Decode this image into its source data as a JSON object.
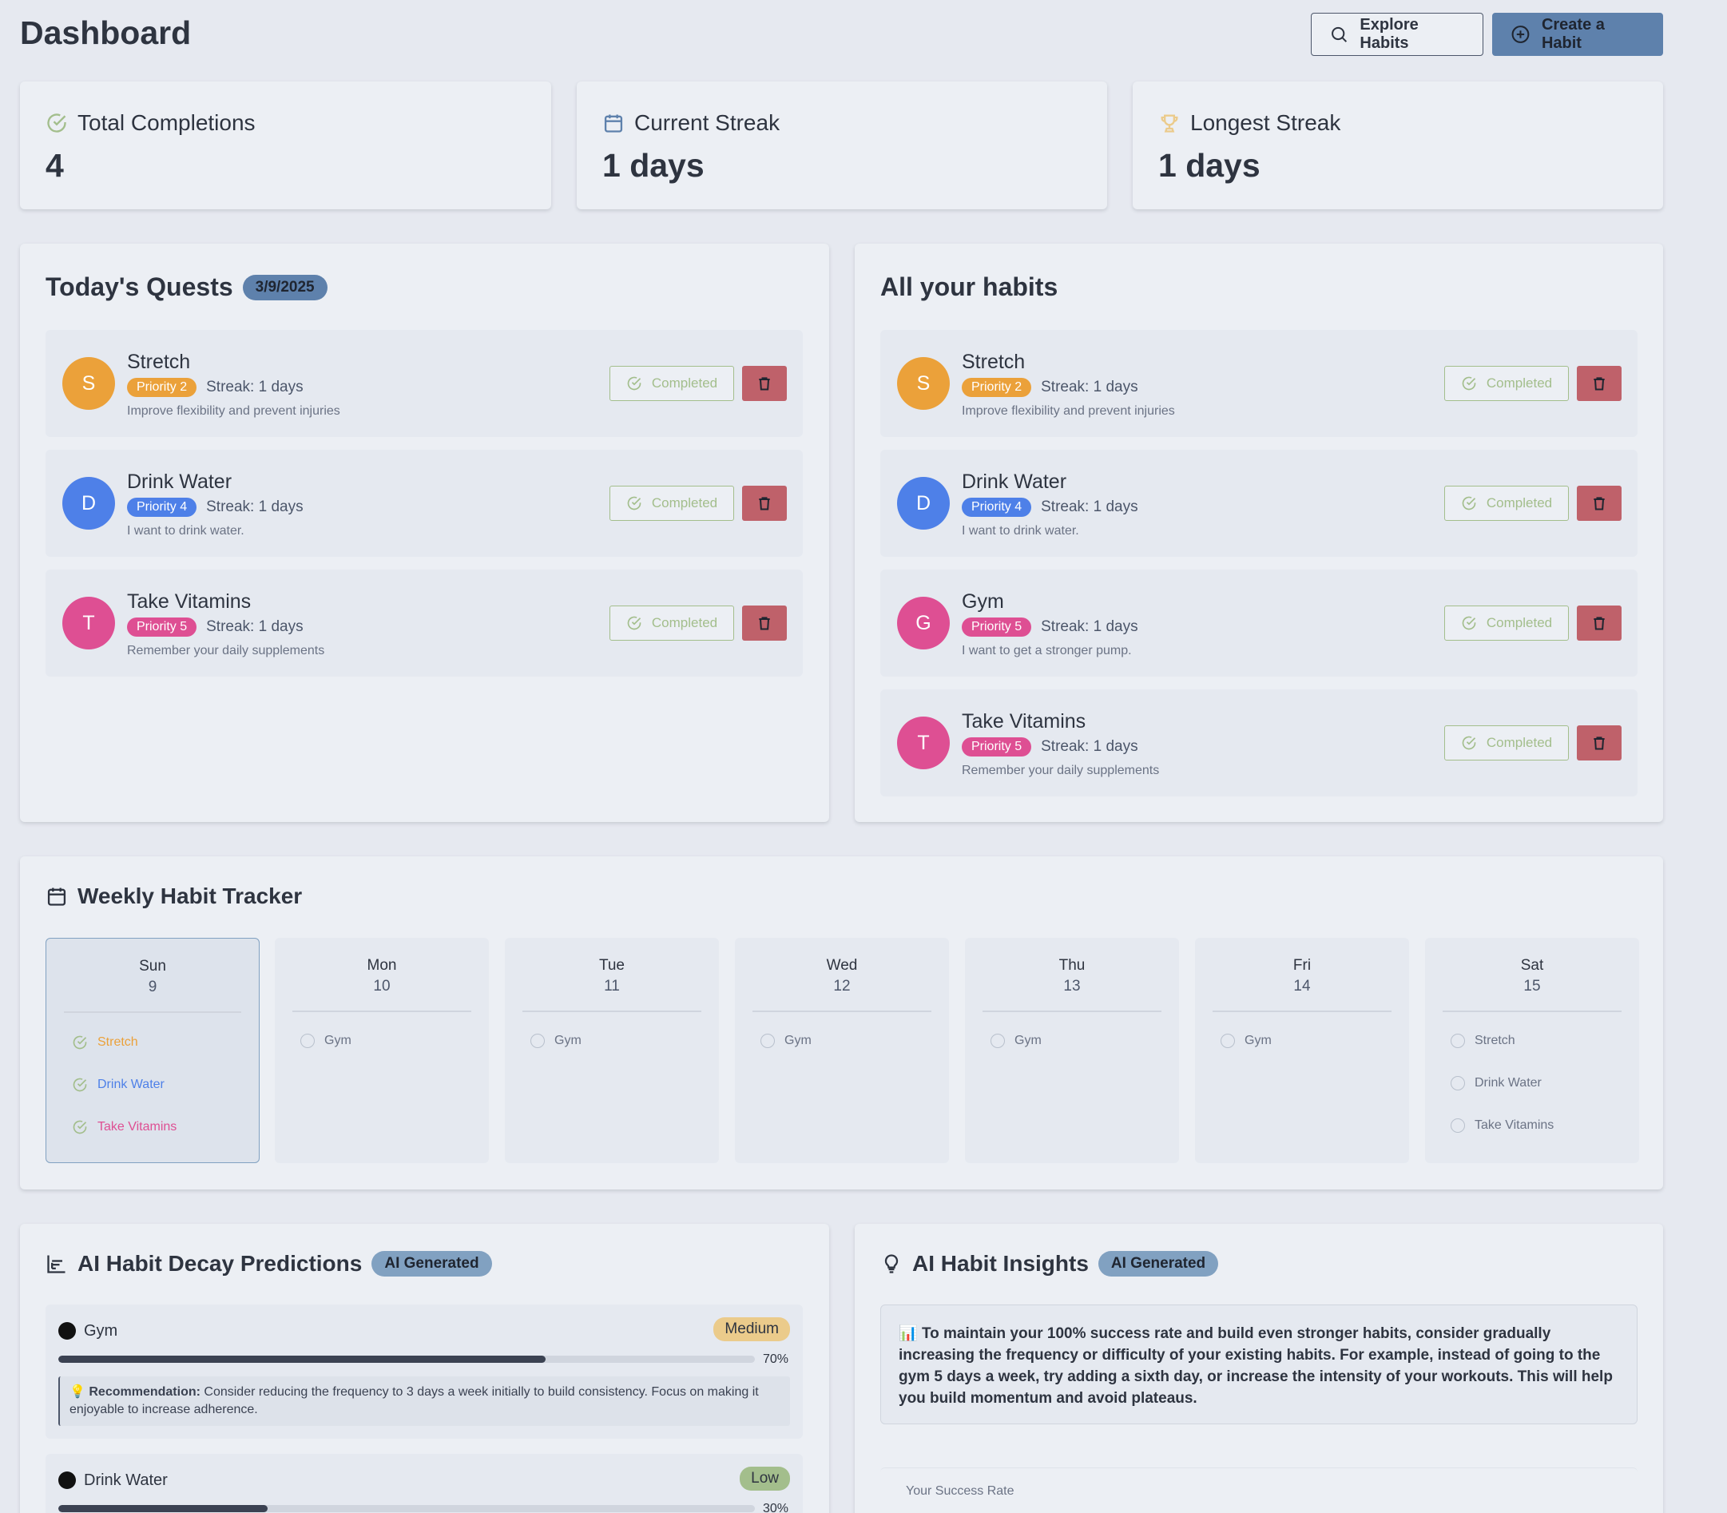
{
  "header": {
    "title": "Dashboard",
    "explore_label": "Explore Habits",
    "create_label": "Create a Habit"
  },
  "stats": [
    {
      "label": "Total Completions",
      "value": "4",
      "icon": "check-circle-icon",
      "icon_color": "#a3be8c"
    },
    {
      "label": "Current Streak",
      "value": "1 days",
      "icon": "calendar-icon",
      "icon_color": "#5e81ac"
    },
    {
      "label": "Longest Streak",
      "value": "1 days",
      "icon": "trophy-icon",
      "icon_color": "#ebcb8b"
    }
  ],
  "today": {
    "title": "Today's Quests",
    "date": "3/9/2025",
    "habits": [
      {
        "initial": "S",
        "name": "Stretch",
        "priority": "Priority 2",
        "streak": "Streak: 1 days",
        "desc": "Improve flexibility and prevent injuries",
        "color": "#eba13a",
        "button": "Completed"
      },
      {
        "initial": "D",
        "name": "Drink Water",
        "priority": "Priority 4",
        "streak": "Streak: 1 days",
        "desc": "I want to drink water.",
        "color": "#4e80e8",
        "button": "Completed"
      },
      {
        "initial": "T",
        "name": "Take Vitamins",
        "priority": "Priority 5",
        "streak": "Streak: 1 days",
        "desc": "Remember your daily supplements",
        "color": "#de4f93",
        "button": "Completed"
      }
    ]
  },
  "all_habits": {
    "title": "All your habits",
    "habits": [
      {
        "initial": "S",
        "name": "Stretch",
        "priority": "Priority 2",
        "streak": "Streak: 1 days",
        "desc": "Improve flexibility and prevent injuries",
        "color": "#eba13a",
        "button": "Completed"
      },
      {
        "initial": "D",
        "name": "Drink Water",
        "priority": "Priority 4",
        "streak": "Streak: 1 days",
        "desc": "I want to drink water.",
        "color": "#4e80e8",
        "button": "Completed"
      },
      {
        "initial": "G",
        "name": "Gym",
        "priority": "Priority 5",
        "streak": "Streak: 1 days",
        "desc": "I want to get a stronger pump.",
        "color": "#de4f93",
        "button": "Completed"
      },
      {
        "initial": "T",
        "name": "Take Vitamins",
        "priority": "Priority 5",
        "streak": "Streak: 1 days",
        "desc": "Remember your daily supplements",
        "color": "#de4f93",
        "button": "Completed"
      }
    ]
  },
  "weekly": {
    "title": "Weekly Habit Tracker",
    "days": [
      {
        "name": "Sun",
        "num": "9",
        "items": [
          {
            "label": "Stretch",
            "done": true,
            "color": "#eba13a"
          },
          {
            "label": "Drink Water",
            "done": true,
            "color": "#4e80e8"
          },
          {
            "label": "Take Vitamins",
            "done": true,
            "color": "#de4f93"
          }
        ]
      },
      {
        "name": "Mon",
        "num": "10",
        "items": [
          {
            "label": "Gym",
            "done": false
          }
        ]
      },
      {
        "name": "Tue",
        "num": "11",
        "items": [
          {
            "label": "Gym",
            "done": false
          }
        ]
      },
      {
        "name": "Wed",
        "num": "12",
        "items": [
          {
            "label": "Gym",
            "done": false
          }
        ]
      },
      {
        "name": "Thu",
        "num": "13",
        "items": [
          {
            "label": "Gym",
            "done": false
          }
        ]
      },
      {
        "name": "Fri",
        "num": "14",
        "items": [
          {
            "label": "Gym",
            "done": false
          }
        ]
      },
      {
        "name": "Sat",
        "num": "15",
        "items": [
          {
            "label": "Stretch",
            "done": false
          },
          {
            "label": "Drink Water",
            "done": false
          },
          {
            "label": "Take Vitamins",
            "done": false
          }
        ]
      }
    ]
  },
  "decay": {
    "title": "AI Habit Decay Predictions",
    "badge": "AI Generated",
    "items": [
      {
        "name": "Gym",
        "level": "Medium",
        "level_color": "#ebcb8b",
        "percent": 70,
        "percent_label": "70%",
        "rec_label": "Recommendation:",
        "rec_text": " Consider reducing the frequency to 3 days a week initially to build consistency. Focus on making it enjoyable to increase adherence.",
        "rec_icon": "💡"
      },
      {
        "name": "Drink Water",
        "level": "Low",
        "level_color": "#a3be8c",
        "percent": 30,
        "percent_label": "30%"
      }
    ]
  },
  "insights": {
    "title": "AI Habit Insights",
    "badge": "AI Generated",
    "icon": "📊",
    "text": "To maintain your 100% success rate and build even stronger habits, consider gradually increasing the frequency or difficulty of your existing habits. For example, instead of going to the gym 5 days a week, try adding a sixth day, or increase the intensity of your workouts. This will help you build momentum and avoid plateaus.",
    "success_label": "Your Success Rate"
  }
}
